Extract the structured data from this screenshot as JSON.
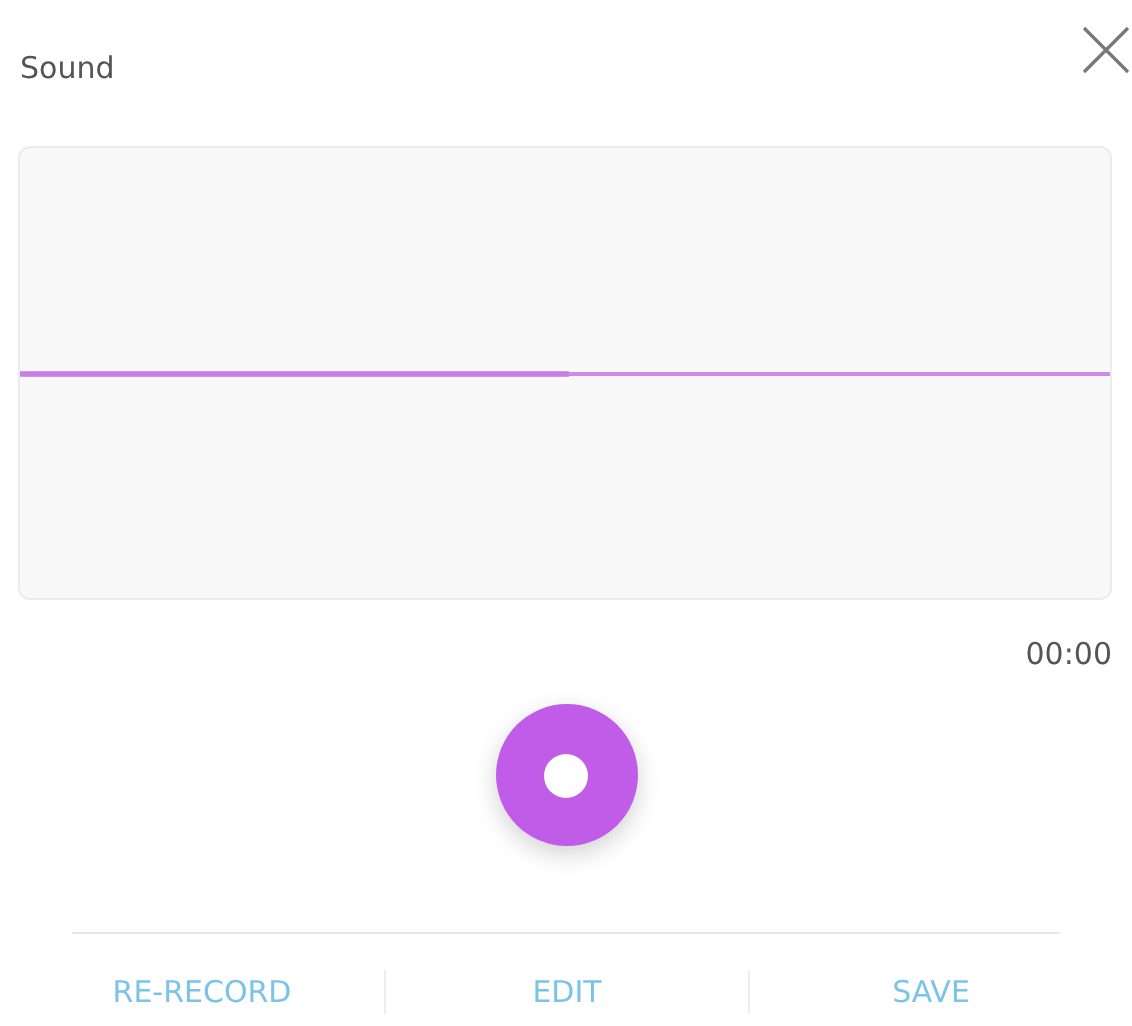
{
  "title": "Sound",
  "timer": "00:00",
  "actions": [
    {
      "label": "RE-RECORD"
    },
    {
      "label": "EDIT"
    },
    {
      "label": "SAVE"
    }
  ]
}
